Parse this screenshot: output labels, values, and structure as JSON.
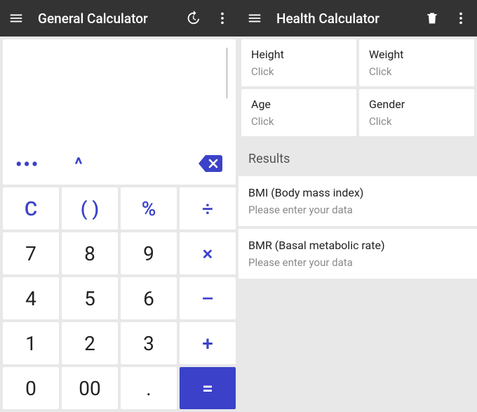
{
  "colors": {
    "accent": "#3b42c9",
    "appbar": "#333333",
    "muted": "#8a8a8a"
  },
  "left": {
    "title": "General Calculator",
    "display": "",
    "toolrow": {
      "more": "•••",
      "caret": "^"
    },
    "keys": [
      {
        "label": "C",
        "kind": "op",
        "name": "key-clear"
      },
      {
        "label": "( )",
        "kind": "op",
        "name": "key-parens"
      },
      {
        "label": "%",
        "kind": "op",
        "name": "key-percent"
      },
      {
        "label": "÷",
        "kind": "op",
        "name": "key-divide"
      },
      {
        "label": "7",
        "kind": "num",
        "name": "key-7"
      },
      {
        "label": "8",
        "kind": "num",
        "name": "key-8"
      },
      {
        "label": "9",
        "kind": "num",
        "name": "key-9"
      },
      {
        "label": "×",
        "kind": "op",
        "name": "key-multiply"
      },
      {
        "label": "4",
        "kind": "num",
        "name": "key-4"
      },
      {
        "label": "5",
        "kind": "num",
        "name": "key-5"
      },
      {
        "label": "6",
        "kind": "num",
        "name": "key-6"
      },
      {
        "label": "–",
        "kind": "op",
        "name": "key-minus"
      },
      {
        "label": "1",
        "kind": "num",
        "name": "key-1"
      },
      {
        "label": "2",
        "kind": "num",
        "name": "key-2"
      },
      {
        "label": "3",
        "kind": "num",
        "name": "key-3"
      },
      {
        "label": "+",
        "kind": "op",
        "name": "key-plus"
      },
      {
        "label": "0",
        "kind": "num",
        "name": "key-0"
      },
      {
        "label": "00",
        "kind": "num",
        "name": "key-00"
      },
      {
        "label": ".",
        "kind": "num",
        "name": "key-decimal"
      },
      {
        "label": "=",
        "kind": "eq",
        "name": "key-equals"
      }
    ]
  },
  "right": {
    "title": "Health Calculator",
    "fields": [
      {
        "label": "Height",
        "placeholder": "Click",
        "name": "field-height"
      },
      {
        "label": "Weight",
        "placeholder": "Click",
        "name": "field-weight"
      },
      {
        "label": "Age",
        "placeholder": "Click",
        "name": "field-age"
      },
      {
        "label": "Gender",
        "placeholder": "Click",
        "name": "field-gender"
      }
    ],
    "results_header": "Results",
    "results": [
      {
        "label": "BMI (Body mass index)",
        "value": "Please enter your data",
        "name": "result-bmi"
      },
      {
        "label": "BMR (Basal metabolic rate)",
        "value": "Please enter your data",
        "name": "result-bmr"
      }
    ]
  }
}
